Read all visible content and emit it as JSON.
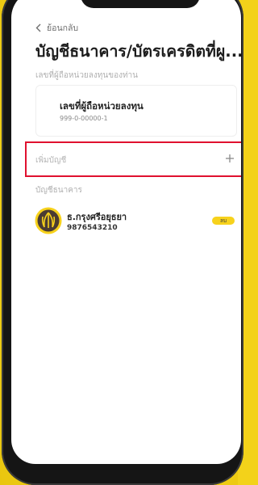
{
  "header": {
    "back_label": "ย้อนกลับ",
    "title": "บัญชีธนาคาร/บัตรเครดิตที่ผู..."
  },
  "holder_section": {
    "label": "เลขที่ผู้ถือหน่วยลงทุนของท่าน",
    "card_title": "เลขที่ผู้ถือหน่วยลงทุน",
    "card_number": "999-0-00000-1"
  },
  "add_account": {
    "label": "เพิ่มบัญชี",
    "icon": "plus-icon",
    "highlight_color": "#e0112f"
  },
  "bank_section": {
    "label": "บัญชีธนาคาร",
    "accounts": [
      {
        "name": "ธ.กรุงศรีอยุธยา",
        "account_number": "9876543210",
        "action_label": "ลบ",
        "logo_color": "#f7d21c",
        "logo_fg": "#4a3c32"
      }
    ]
  },
  "colors": {
    "background": "#f3d21a",
    "accent": "#f7d21c"
  }
}
